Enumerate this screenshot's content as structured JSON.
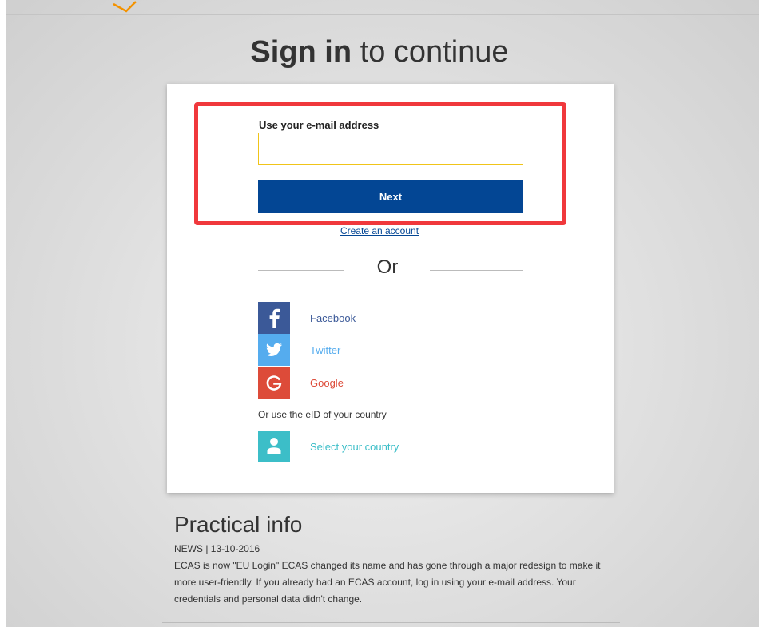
{
  "header": {
    "title_strong": "Sign in",
    "title_rest": " to continue"
  },
  "login": {
    "email_label": "Use your e-mail address",
    "email_value": "",
    "next_label": "Next",
    "create_account_label": "Create an account"
  },
  "divider": {
    "or_label": "Or"
  },
  "social": [
    {
      "name": "Facebook",
      "icon": "facebook-icon",
      "color": "#3b5998",
      "text_color": "#3b5998"
    },
    {
      "name": "Twitter",
      "icon": "twitter-icon",
      "color": "#55acee",
      "text_color": "#55acee"
    },
    {
      "name": "Google",
      "icon": "google-icon",
      "color": "#dd4b39",
      "text_color": "#dd4b39"
    }
  ],
  "eid": {
    "prompt": "Or use the eID of your country",
    "select_label": "Select your country",
    "icon": "person-icon",
    "color": "#3cbec8"
  },
  "practical": {
    "title": "Practical info",
    "news_line": "NEWS | 13-10-2016",
    "news_body": "ECAS is now \"EU Login\" ECAS changed its name and has gone through a major redesign to make it more user-friendly. If you already had an ECAS account, log in using your e-mail address. Your credentials and personal data didn't change."
  },
  "colors": {
    "primary_button": "#034694",
    "input_border": "#f0c419",
    "highlight": "#f0383c",
    "accent_logo": "#f39200"
  }
}
